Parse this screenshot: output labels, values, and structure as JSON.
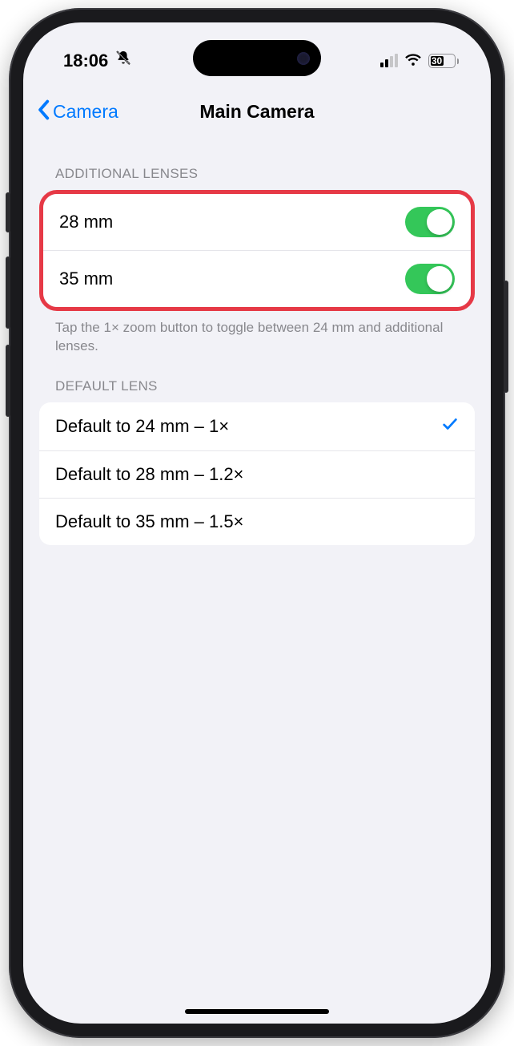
{
  "status": {
    "time": "18:06",
    "battery_percent": "30"
  },
  "nav": {
    "back_label": "Camera",
    "title": "Main Camera"
  },
  "additional_lenses": {
    "header": "ADDITIONAL LENSES",
    "items": [
      {
        "label": "28 mm",
        "on": true
      },
      {
        "label": "35 mm",
        "on": true
      }
    ],
    "footer": "Tap the 1× zoom button to toggle between 24 mm and additional lenses."
  },
  "default_lens": {
    "header": "DEFAULT LENS",
    "items": [
      {
        "label": "Default to 24 mm – 1×",
        "selected": true
      },
      {
        "label": "Default to 28 mm – 1.2×",
        "selected": false
      },
      {
        "label": "Default to 35 mm – 1.5×",
        "selected": false
      }
    ]
  }
}
